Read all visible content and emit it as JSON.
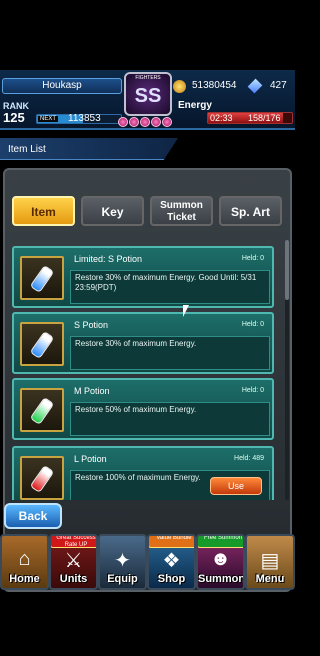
{
  "player": {
    "name": "Houkasp",
    "rank_label": "RANK",
    "rank": "125",
    "next_label": "NEXT",
    "next_exp": "113853",
    "exp_fraction": 0.55,
    "coins": "51380454",
    "gems": "427",
    "energy_label": "Energy",
    "energy_timer": "02:33",
    "energy": "158/176",
    "energy_fraction": 0.898
  },
  "badge": {
    "rank_letters": "SS",
    "caption": "FIGHTERS"
  },
  "header": {
    "title": "Item List"
  },
  "tabs": [
    {
      "label": "Item",
      "active": true
    },
    {
      "label": "Key",
      "active": false
    },
    {
      "label": "Summon Ticket",
      "active": false
    },
    {
      "label": "Sp. Art",
      "active": false
    }
  ],
  "items": [
    {
      "name": "Limited: S Potion",
      "held": "Held: 0",
      "desc": "Restore 30% of maximum Energy. Good Until: 5/31 23:59(PDT)",
      "color": "blue"
    },
    {
      "name": "S Potion",
      "held": "Held: 0",
      "desc": "Restore 30% of maximum Energy.",
      "color": "blue"
    },
    {
      "name": "M Potion",
      "held": "Held: 0",
      "desc": "Restore 50% of maximum Energy.",
      "color": "green"
    },
    {
      "name": "L Potion",
      "held": "Held: 489",
      "desc": "Restore 100% of maximum Energy.",
      "color": "red",
      "use_label": "Use"
    }
  ],
  "back_label": "Back",
  "nav": [
    {
      "label": "Home"
    },
    {
      "label": "Units",
      "tag": "Great Success Rate UP"
    },
    {
      "label": "Equip"
    },
    {
      "label": "Shop",
      "tag": "Value Bundle"
    },
    {
      "label": "Summon",
      "tag": "Free Summon"
    },
    {
      "label": "Menu"
    }
  ]
}
